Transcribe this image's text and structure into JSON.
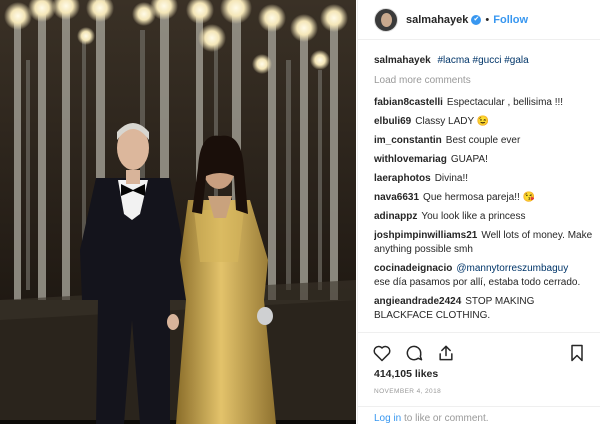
{
  "post": {
    "username": "salmahayek",
    "follow_label": "Follow",
    "dot": "•",
    "caption_user": "salmahayek",
    "caption_tags": [
      "#lacma",
      "#gucci",
      "#gala"
    ],
    "load_more": "Load more comments",
    "comments": [
      {
        "user": "fabian8castelli",
        "text": "Espectacular , bellisima !!!"
      },
      {
        "user": "elbuli69",
        "text": "Classy LADY 😉"
      },
      {
        "user": "im_constantin",
        "text": "Best couple ever"
      },
      {
        "user": "withlovemariag",
        "text": "GUAPA!"
      },
      {
        "user": "laeraphotos",
        "text": "Divina!!"
      },
      {
        "user": "nava6631",
        "text": "Que hermosa pareja!! 😘"
      },
      {
        "user": "adinappz",
        "text": "You look like a princess"
      },
      {
        "user": "joshpimpinwilliams21",
        "text": "Well lots of money. Make anything possible smh"
      },
      {
        "user": "cocinadeignacio",
        "mention": "@mannytorreszumbaguy",
        "text": "ese día pasamos por allí, estaba todo cerrado."
      },
      {
        "user": "angieandrade2424",
        "text": "STOP MAKING BLACKFACE CLOTHING."
      }
    ],
    "likes": "414,105 likes",
    "date": "NOVEMBER 4, 2018",
    "login_link": "Log in",
    "login_rest": " to like or comment."
  },
  "icons": {
    "verified": "verified-badge-icon",
    "heart": "heart-icon",
    "comment": "comment-icon",
    "share": "share-icon",
    "bookmark": "bookmark-icon",
    "verified_glyph": "✔"
  },
  "colors": {
    "link": "#3897f0",
    "text": "#262626",
    "muted": "#999999",
    "gown": "#c8a54a",
    "tuxedo": "#14141c"
  }
}
